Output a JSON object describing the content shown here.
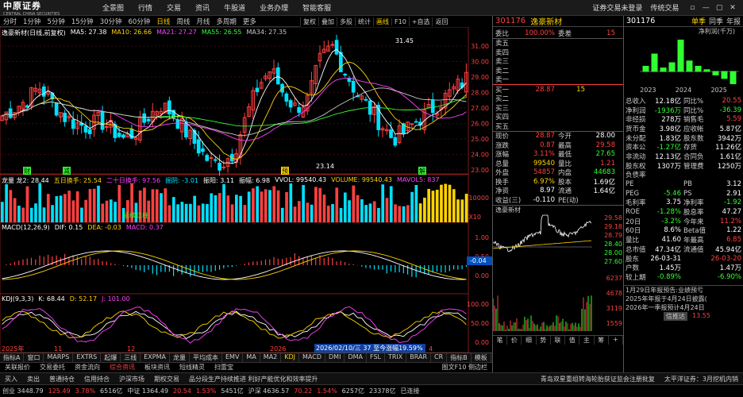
{
  "menubar": {
    "logo": "中原证券",
    "logo_sub": "CENTRAL CHINA SECURITIES",
    "items": [
      "全景图",
      "行情",
      "交易",
      "资讯",
      "牛股道",
      "业务办理",
      "智能客服"
    ],
    "right_items": [
      "证券交易未登录",
      "传统交易"
    ],
    "window_buttons": [
      "▫",
      "—",
      "▢",
      "✕"
    ]
  },
  "periods": {
    "items": [
      "分时",
      "1分钟",
      "5分钟",
      "15分钟",
      "30分钟",
      "60分钟",
      "日线",
      "周线",
      "月线",
      "多周期",
      "更多"
    ],
    "selected": "日线"
  },
  "toolbar2": {
    "items": [
      "复权",
      "叠加",
      "多股",
      "统计",
      "画线",
      "F10",
      "+自选",
      "返回"
    ],
    "selected": "画线"
  },
  "main_chart": {
    "legend": [
      {
        "text": "逸豪新材(日线,前复权)",
        "color": "#ffffff"
      },
      {
        "text": "MA5: 27.38",
        "color": "#ffffff"
      },
      {
        "text": "MA10: 26.66",
        "color": "#ffd400"
      },
      {
        "text": "MA21: 27.27",
        "color": "#ff40ff"
      },
      {
        "text": "MA55: 26.55",
        "color": "#30ff30"
      },
      {
        "text": "MA34: 27.35",
        "color": "#c8c8c8"
      }
    ],
    "price_labels": [
      "31.00",
      "30.00",
      "29.00",
      "28.00",
      "27.00",
      "26.00",
      "25.00",
      "24.00",
      "23.00"
    ],
    "high_annotation": "31.45",
    "low_annotation": "23.14",
    "marks": [
      "财",
      "减",
      "预",
      "解"
    ]
  },
  "volume_chart": {
    "legend": [
      {
        "text": "龙量 龙2: 28.44",
        "color": "#ffffff"
      },
      {
        "text": "五日换手: 25.54",
        "color": "#ffd400"
      },
      {
        "text": "二十日换手: 97.56",
        "color": "#ff40ff"
      },
      {
        "text": "掘阴: -3.01",
        "color": "#00e0ff"
      },
      {
        "text": "振阳: 3.11",
        "color": "#ffffff"
      },
      {
        "text": "振幅: 6.98",
        "color": "#ffffff"
      },
      {
        "text": "VVOL: 99540.43",
        "color": "#ffffff"
      },
      {
        "text": "VOLUME: 99540.43",
        "color": "#ffd400"
      },
      {
        "text": "MAVOL5: 837",
        "color": "#ff40ff"
      }
    ],
    "label": "10000",
    "label2": "X10",
    "tag": "延续红柱"
  },
  "macd_chart": {
    "legend": [
      {
        "text": "MACD(12,26,9)",
        "color": "#ffffff"
      },
      {
        "text": "DIF: 0.15",
        "color": "#ffffff"
      },
      {
        "text": "DEA: -0.03",
        "color": "#ffd400"
      },
      {
        "text": "MACD: 0.37",
        "color": "#ff40ff"
      }
    ],
    "scale": [
      "1.00",
      "0.50",
      "0.00"
    ],
    "current": "-0.04"
  },
  "kdj_chart": {
    "legend": [
      {
        "text": "KDJ(9,3,3)",
        "color": "#ffffff"
      },
      {
        "text": "K: 68.44",
        "color": "#ffffff"
      },
      {
        "text": "D: 52.17",
        "color": "#ffd400"
      },
      {
        "text": "J: 101.00",
        "color": "#ff40ff"
      }
    ],
    "scale": [
      "100.00",
      "50.00",
      "0.00"
    ],
    "date_labels": [
      "2025年",
      "11",
      "12",
      "2026",
      "2",
      "3",
      "4"
    ],
    "tooltip": "2026/02/10/三 37 至今涨幅19.59%"
  },
  "bottom_tabs": {
    "items": [
      "指标A",
      "窗口",
      "MARPS",
      "EXTRS",
      "起爆",
      "三线",
      "EXPMA",
      "龙量",
      "平均成本",
      "EMV",
      "MA",
      "MA2",
      "KDJ",
      "MACD",
      "DMI",
      "DMA",
      "FSL",
      "TRIX",
      "BRAR",
      "CR"
    ],
    "selected": "KDJ",
    "right": [
      "指标B",
      "模板"
    ]
  },
  "bottom_tabs2": {
    "items": [
      "关联报价",
      "交易委托",
      "资金流向",
      "综合资讯",
      "板块资讯",
      "短线精灵",
      "扫雷宝"
    ],
    "selected": "综合资讯",
    "right": "图文F10 侧边栏"
  },
  "quote": {
    "code": "301176",
    "name": "逸豪新材",
    "weibi_label": "委比",
    "weibi": "100.00%",
    "weicha_label": "委差",
    "weicha": "15",
    "sell": [
      "卖五",
      "卖四",
      "卖三",
      "卖二",
      "卖一"
    ],
    "buy": [
      {
        "label": "买一",
        "price": "28.87",
        "vol": "15"
      },
      {
        "label": "买二",
        "price": "",
        "vol": ""
      },
      {
        "label": "买三",
        "price": "",
        "vol": ""
      },
      {
        "label": "买四",
        "price": "",
        "vol": ""
      },
      {
        "label": "买五",
        "price": "",
        "vol": ""
      }
    ],
    "stats": [
      {
        "k1": "现价",
        "v1": "28.87",
        "c1": "red",
        "k2": "今开",
        "v2": "28.00",
        "c2": "white"
      },
      {
        "k1": "涨跌",
        "v1": "0.87",
        "c1": "red",
        "k2": "最高",
        "v2": "29.58",
        "c2": "red"
      },
      {
        "k1": "涨幅",
        "v1": "3.11%",
        "c1": "red",
        "k2": "最低",
        "v2": "27.65",
        "c2": "green"
      },
      {
        "k1": "总量",
        "v1": "99540",
        "c1": "yellow",
        "k2": "量比",
        "v2": "1.21",
        "c2": "red"
      },
      {
        "k1": "外盘",
        "v1": "54857",
        "c1": "red",
        "k2": "内盘",
        "v2": "44683",
        "c2": "green"
      },
      {
        "k1": "换手",
        "v1": "6.97%",
        "c1": "yellow",
        "k2": "股本",
        "v2": "1.69亿",
        "c2": "white"
      },
      {
        "k1": "净资",
        "v1": "8.97",
        "c1": "white",
        "k2": "流通",
        "v2": "1.64亿",
        "c2": "white"
      },
      {
        "k1": "收益(三)",
        "v1": "-0.110",
        "c1": "white",
        "k2": "PE(动)",
        "v2": "",
        "c2": "white"
      }
    ],
    "intraday_name": "逸豪新材",
    "intraday_scale": [
      "29.58",
      "29.18",
      "28.79",
      "28.40",
      "28.00",
      "27.60"
    ],
    "vol_scale": [
      "6237",
      "4678",
      "3119",
      "1559"
    ],
    "tabs": [
      "笔",
      "价",
      "细",
      "势",
      "联",
      "值",
      "主",
      "筹",
      "+"
    ]
  },
  "finance": {
    "code": "301176",
    "tabs": [
      "单季",
      "同季",
      "年报"
    ],
    "selected_tab": "单季",
    "chart_title": "净利润(千万)",
    "years": [
      "2023",
      "2024",
      "2025"
    ],
    "chart_data": {
      "type": "bar",
      "categories": [
        "2023",
        "2023",
        "2023",
        "2023",
        "2024",
        "2024",
        "2024",
        "2024",
        "2025",
        "2025",
        "2025"
      ],
      "values": [
        0.3,
        1.0,
        0.2,
        0.5,
        1.8,
        0.6,
        0.3,
        0.1,
        -0.2,
        -0.4,
        -1.2
      ],
      "ylabel": "净利润(千万)"
    },
    "rows": [
      {
        "k1": "总收入",
        "v1": "12.18亿",
        "k2": "同比%",
        "v2": "20.55",
        "c2": "red"
      },
      {
        "k1": "净利润",
        "v1": "-1936万",
        "k2": "同比%",
        "v2": "-36.39",
        "c2": "green"
      },
      {
        "k1": "非经损",
        "v1": "278万",
        "k2": "销售毛",
        "v2": "5.59",
        "c2": "red"
      },
      {
        "k1": "货币金",
        "v1": "3.98亿",
        "k2": "应收帐",
        "v2": "5.87亿",
        "c2": "white"
      },
      {
        "k1": "未分配",
        "v1": "1.83亿",
        "k2": "股东数",
        "v2": "3942万",
        "c2": "white"
      },
      {
        "k1": "资本公",
        "v1": "-1.27亿",
        "k2": "存货",
        "v2": "11.26亿",
        "c2": "white"
      },
      {
        "k1": "非流动",
        "v1": "12.13亿",
        "k2": "合同负",
        "v2": "1.61亿",
        "c2": "white"
      },
      {
        "k1": "股东权",
        "v1": "1307万",
        "k2": "管理费",
        "v2": "1250万",
        "c2": "white"
      },
      {
        "k1": "负债率",
        "v1": "",
        "k2": "",
        "v2": "",
        "c2": "white"
      },
      {
        "k1": "PE",
        "v1": "",
        "k2": "PB",
        "v2": "3.12",
        "c2": "white"
      },
      {
        "k1": "PEG",
        "v1": "-5.46",
        "k2": "PS",
        "v2": "2.91",
        "c2": "white"
      },
      {
        "k1": "毛利率",
        "v1": "3.75",
        "k2": "净利率",
        "v2": "-1.92",
        "c2": "green"
      },
      {
        "k1": "ROE",
        "v1": "-1.28%",
        "k2": "股息率",
        "v2": "47.27",
        "c2": "white"
      },
      {
        "k1": "20日",
        "v1": "-3.2%",
        "k2": "今年来",
        "v2": "11.2%",
        "c2": "red"
      },
      {
        "k1": "60日",
        "v1": "8.6%",
        "k2": "Beta值",
        "v2": "1.22",
        "c2": "white"
      },
      {
        "k1": "量比",
        "v1": "41.60",
        "k2": "年最高",
        "v2": "6.85",
        "c2": "red"
      },
      {
        "k1": "总市值",
        "v1": "47.34亿",
        "k2": "流通值",
        "v2": "45.94亿",
        "c2": "white"
      },
      {
        "k1": "股东",
        "v1": "26-03-31",
        "k2": "",
        "v2": "26-03-20",
        "c2": "red"
      },
      {
        "k1": "户数",
        "v1": "1.45万",
        "k2": "",
        "v2": "1.47万",
        "c2": "white"
      },
      {
        "k1": "较上期",
        "v1": "-0.89%",
        "k2": "",
        "v2": "-6.90%",
        "c2": "green"
      }
    ],
    "news": [
      "1月29日年报预告:业绩预亏",
      "2025年年报于4月24日披露(",
      "2026年一季报预计4月24日"
    ],
    "news_btn": "信推达",
    "news_val": "13.55"
  },
  "funcbar": {
    "items": [
      "买入",
      "卖出",
      "普通持仓",
      "信用持合",
      "沪深市场",
      "期权交易"
    ],
    "news": "品分段生产持续推进 利好产能优化和效率提升",
    "news2": "青岛双星重组转海轮胎获证监会注册批复",
    "right": "太平洋证券：3月挖机内销"
  },
  "statusbar": [
    {
      "text": "创业 3448.79",
      "color": "#ccc"
    },
    {
      "text": "125.49",
      "color": "#ff4040"
    },
    {
      "text": "3.78%",
      "color": "#ff4040"
    },
    {
      "text": "6516亿",
      "color": "#ccc"
    },
    {
      "text": "中证 1364.49",
      "color": "#ccc"
    },
    {
      "text": "20.54",
      "color": "#ff4040"
    },
    {
      "text": "1.53%",
      "color": "#ff4040"
    },
    {
      "text": "5451亿",
      "color": "#ccc"
    },
    {
      "text": "沪深 4636.57",
      "color": "#ccc"
    },
    {
      "text": "70.22",
      "color": "#ff4040"
    },
    {
      "text": "1.54%",
      "color": "#ff4040"
    },
    {
      "text": "6257亿",
      "color": "#ccc"
    },
    {
      "text": "23378亿",
      "color": "#ccc"
    },
    {
      "text": "已连接",
      "color": "#ccc"
    }
  ]
}
